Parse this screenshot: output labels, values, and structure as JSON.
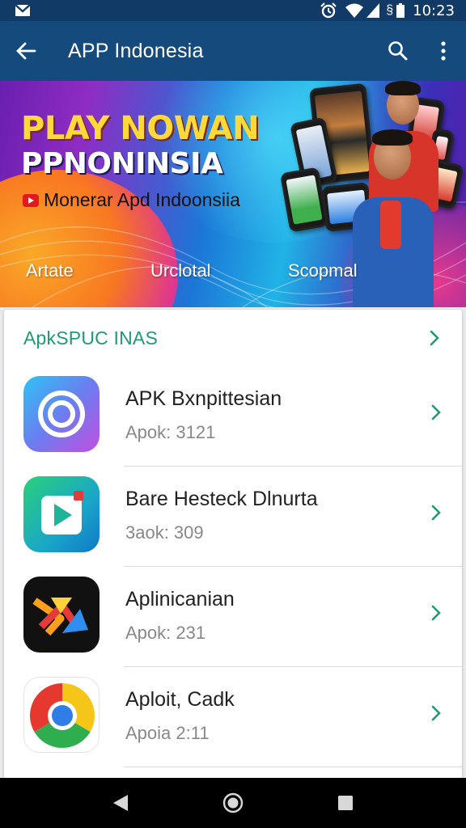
{
  "status_bar": {
    "time": "10:23",
    "icons": [
      "gmail-icon",
      "alarm-icon",
      "wifi-icon",
      "signal-icon",
      "data-icon",
      "battery-icon"
    ]
  },
  "app_bar": {
    "title": "APP Indonesia",
    "icons": [
      "back-arrow-icon",
      "search-icon",
      "more-vert-icon"
    ]
  },
  "banner": {
    "headline": "PLAY NOWAN",
    "headline2": "PPNONINSIA",
    "subtitle": "Monerar Apd Indoonsiia",
    "tags": [
      "Artate",
      "Urclotal",
      "Scopmal"
    ]
  },
  "section": {
    "title": "ApkSPUC INAS"
  },
  "apps": [
    {
      "name": "APK Bxnpittesian",
      "sub": "Apok: 3121"
    },
    {
      "name": "Bare Hesteck Dlnurta",
      "sub": "3aok: 309"
    },
    {
      "name": "Aplinicanian",
      "sub": "Apok: 231"
    },
    {
      "name": "Aploit, Cadk",
      "sub": "Apoia 2:11"
    }
  ],
  "colors": {
    "status_bar": "#123a66",
    "app_bar": "#154a7c",
    "accent_green": "#1f9a72",
    "nav_bar": "#000000"
  },
  "nav_bar": {
    "icons": [
      "back-triangle-icon",
      "home-circle-icon",
      "recents-square-icon"
    ]
  }
}
